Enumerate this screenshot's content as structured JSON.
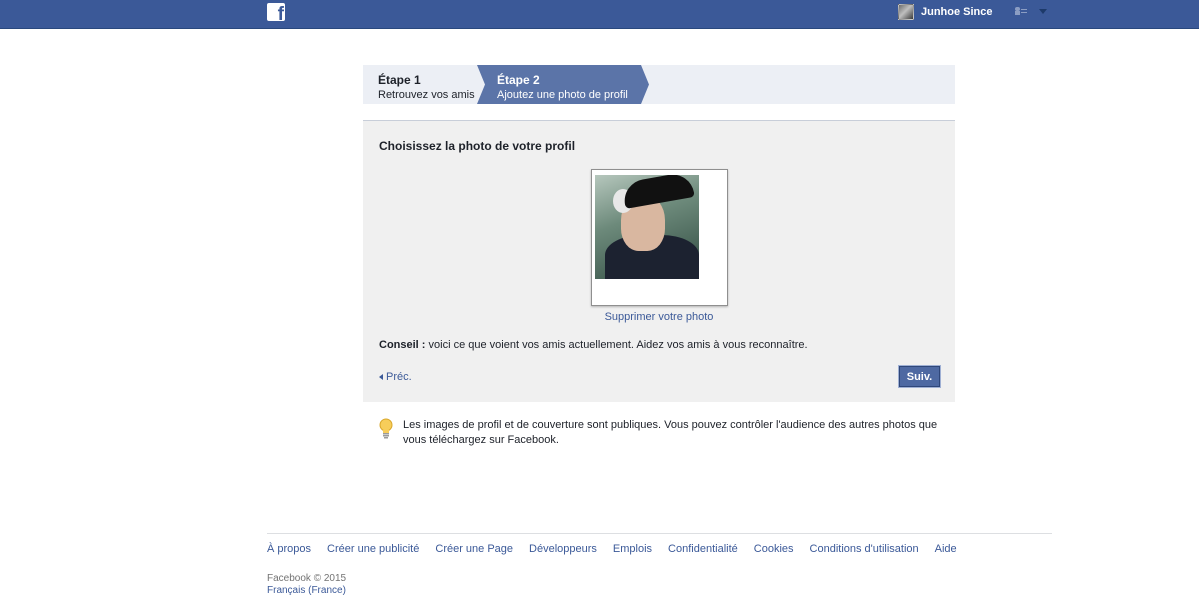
{
  "topbar": {
    "logo_letter": "f",
    "user_name": "Junhoe Since",
    "colors": {
      "bar": "#3b5998"
    }
  },
  "steps": [
    {
      "title": "Étape 1",
      "subtitle": "Retrouvez vos amis"
    },
    {
      "title": "Étape 2",
      "subtitle": "Ajoutez une photo de profil"
    }
  ],
  "panel": {
    "title": "Choisissez la photo de votre profil",
    "remove_photo": "Supprimer votre photo",
    "tip_label": "Conseil :",
    "tip_text": " voici ce que voient vos amis actuellement. Aidez vos amis à vous reconnaître.",
    "prev_label": "Préc.",
    "next_label": "Suiv."
  },
  "info": {
    "icon": "lightbulb-icon",
    "text": "Les images de profil et de couverture sont publiques. Vous pouvez contrôler l'audience des autres photos que vous téléchargez sur Facebook."
  },
  "footer": {
    "links": [
      "À propos",
      "Créer une publicité",
      "Créer une Page",
      "Développeurs",
      "Emplois",
      "Confidentialité",
      "Cookies",
      "Conditions d'utilisation",
      "Aide"
    ],
    "copyright": "Facebook © 2015",
    "language": "Français (France)"
  }
}
